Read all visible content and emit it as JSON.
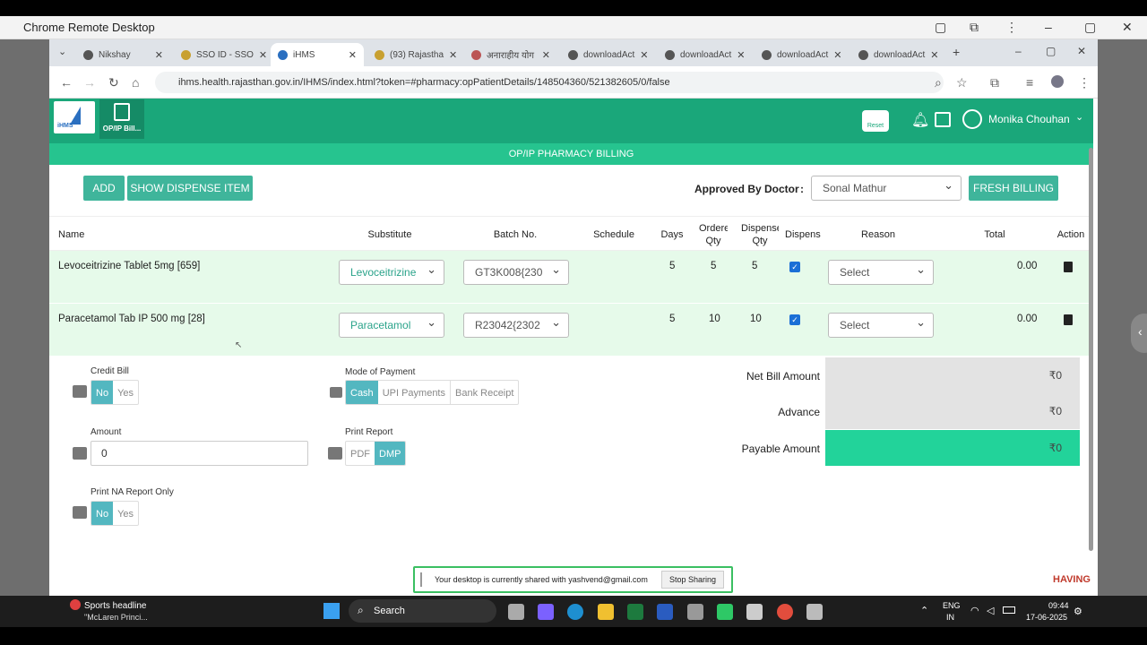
{
  "outer": {
    "title": "Chrome Remote Desktop"
  },
  "tabs": [
    {
      "label": "Nikshay"
    },
    {
      "label": "SSO ID - SSO"
    },
    {
      "label": "iHMS"
    },
    {
      "label": "(93) Rajastha"
    },
    {
      "label": "अनाराहीय योग"
    },
    {
      "label": "downloadAct"
    },
    {
      "label": "downloadAct"
    },
    {
      "label": "downloadAct"
    },
    {
      "label": "downloadAct"
    }
  ],
  "address": {
    "url": "ihms.health.rajasthan.gov.in/IHMS/index.html?token=#pharmacy:opPatientDetails/148504360/521382605/0/false"
  },
  "header": {
    "logo": "iHMS",
    "module": "OP/IP Bill...",
    "reset": "Reset",
    "user": "Monika Chouhan"
  },
  "page": {
    "title": "OP/IP PHARMACY BILLING",
    "add": "ADD",
    "show_dispense": "SHOW DISPENSE ITEM",
    "approved_label": "Approved By Doctor",
    "approved_sep": ":",
    "doctor": "Sonal Mathur",
    "fresh": "FRESH BILLING"
  },
  "columns": {
    "name": "Name",
    "substitute": "Substitute",
    "batch": "Batch No.",
    "schedule": "Schedule",
    "days": "Days",
    "ordered": "Ordered Qty",
    "dispensed": "Dispensed Qty",
    "dispense": "Dispense",
    "reason": "Reason",
    "total": "Total",
    "action": "Action"
  },
  "rows": [
    {
      "name": "Levoceitrizine Tablet 5mg [659]",
      "substitute": "Levoceitrizine",
      "batch": "GT3K008{230",
      "days": "5",
      "ordered": "5",
      "dispensed": "5",
      "reason": "Select",
      "total": "0.00"
    },
    {
      "name": "Paracetamol Tab IP 500 mg [28]",
      "substitute": "Paracetamol",
      "batch": "R23042{2302",
      "days": "5",
      "ordered": "10",
      "dispensed": "10",
      "reason": "Select",
      "total": "0.00"
    }
  ],
  "form": {
    "credit_label": "Credit Bill",
    "no": "No",
    "yes": "Yes",
    "mode_label": "Mode of Payment",
    "cash": "Cash",
    "upi": "UPI Payments",
    "bank": "Bank Receipt",
    "amount_label": "Amount",
    "amount_value": "0",
    "print_label": "Print Report",
    "pdf": "PDF",
    "dmp": "DMP",
    "na_label": "Print NA Report Only"
  },
  "summary": {
    "net_label": "Net Bill Amount",
    "net": "₹0",
    "adv_label": "Advance",
    "adv": "₹0",
    "pay_label": "Payable Amount",
    "pay": "₹0"
  },
  "share": {
    "text": "Your desktop is currently shared with yashvend@gmail.com",
    "stop": "Stop Sharing"
  },
  "ticker": "HAVING",
  "taskbar": {
    "news_title": "Sports headline",
    "news_sub": "\"McLaren Princi...",
    "search": "Search",
    "lang1": "ENG",
    "lang2": "IN",
    "time": "09:44",
    "date": "17-06-2025"
  }
}
